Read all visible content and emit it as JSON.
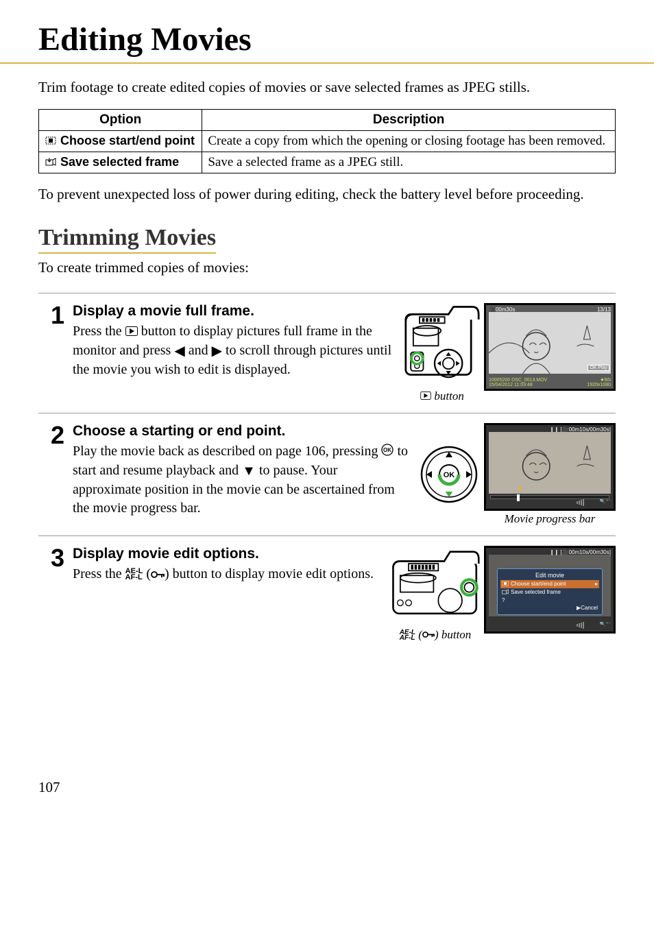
{
  "page": {
    "title": "Editing Movies",
    "intro": "Trim footage to create edited copies of movies or save selected frames as JPEG stills.",
    "note": "To prevent unexpected loss of power during editing, check the battery level before proceeding.",
    "page_number": "107"
  },
  "options_table": {
    "headers": {
      "option": "Option",
      "description": "Description"
    },
    "rows": [
      {
        "icon": "choose-range-icon",
        "name": "Choose start/end point",
        "desc": "Create a copy from which the opening or closing footage has been removed."
      },
      {
        "icon": "save-frame-icon",
        "name": "Save selected frame",
        "desc": "Save a selected frame as a JPEG still."
      }
    ]
  },
  "section": {
    "title": "Trimming Movies",
    "intro": "To create trimmed copies of movies:"
  },
  "steps": {
    "s1": {
      "num": "1",
      "title": "Display a movie full frame.",
      "text_a": "Press the ",
      "text_b": " button to display pictures full frame in the monitor and press ",
      "text_c": " and ",
      "text_d": " to scroll through pictures until the movie you wish to edit is displayed.",
      "caption": " button",
      "lcd": {
        "top_rec": "00m30s",
        "top_count": "13/13",
        "ok_play": "OK Play",
        "bottom_line1": "10005200  DSC_0013.MOV",
        "bottom_line2": "15/04/2012  11:03:48",
        "bottom_star": "★60i",
        "bottom_res": "1920x1080"
      }
    },
    "s2": {
      "num": "2",
      "title": "Choose a starting or end point.",
      "text_a": "Play the movie back as described on page 106, pressing ",
      "text_b": " to start and resume playback and ",
      "text_c": " to pause.  Your approximate position in the movie can be ascertained from the movie progress bar.",
      "caption": "Movie progress bar",
      "lcd": {
        "pause": "❙❙",
        "time": "00m10s/00m30s"
      }
    },
    "s3": {
      "num": "3",
      "title": "Display movie edit options.",
      "text_a": "Press the ",
      "text_b": " (",
      "text_c": ") button to display movie edit options.",
      "caption_a": " (",
      "caption_b": ") button",
      "lcd": {
        "pause": "❙❙",
        "time": "00m10s/00m30s",
        "menu_title": "Edit movie",
        "item1": "Choose start/end point",
        "item2": "Save selected frame",
        "cancel": "▶Cancel"
      }
    }
  }
}
